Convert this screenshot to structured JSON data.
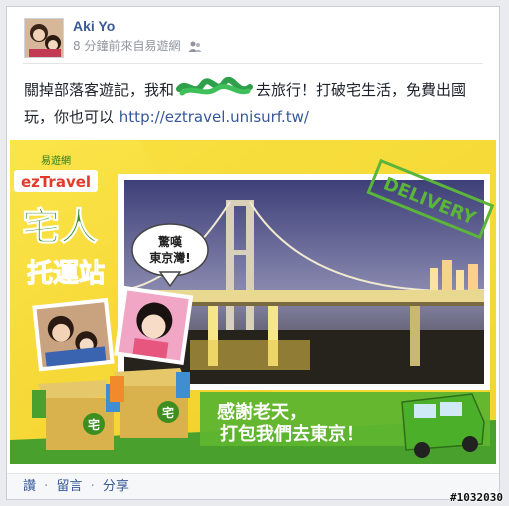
{
  "post": {
    "author": "Aki Yo",
    "meta": "8 分鐘前來自易遊網",
    "text_before": "關掉部落客遊記，我和",
    "text_after": "去旅行！打破宅生活，免費出國玩，你也可以",
    "link": "http://eztravel.unisurf.tw/"
  },
  "banner": {
    "brand_small": "易遊網",
    "brand": "ezTravel",
    "title_line1": "宅人",
    "title_line2": "托運站",
    "bubble_line1": "驚嘆",
    "bubble_line2": "東京灣!",
    "stamp": "DELIVERY",
    "slogan_line1": "感謝老天，",
    "slogan_line2": "打包我們去東京！",
    "box_label": "宅"
  },
  "actions": {
    "like": "讚",
    "comment": "留言",
    "share": "分享"
  },
  "watermark": "#1032030",
  "colors": {
    "link": "#365899",
    "banner_yellow": "#f4d52a",
    "banner_green": "#4aa02c"
  }
}
